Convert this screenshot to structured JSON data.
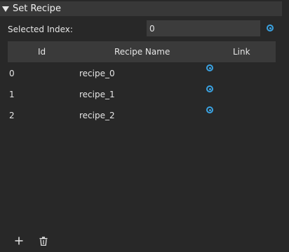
{
  "panel": {
    "title": "Set Recipe"
  },
  "selected_index": {
    "label": "Selected Index:",
    "value": "0"
  },
  "table": {
    "columns": [
      "Id",
      "Recipe Name",
      "Link"
    ],
    "rows": [
      {
        "id": "0",
        "name": "recipe_0"
      },
      {
        "id": "1",
        "name": "recipe_1"
      },
      {
        "id": "2",
        "name": "recipe_2"
      }
    ]
  },
  "colors": {
    "background": "#282828",
    "header": "#383838",
    "accent": "#3aa3e3"
  },
  "icons": {
    "collapse": "triangle-down-icon",
    "link": "radio-link-icon",
    "add": "plus-icon",
    "delete": "trash-icon"
  }
}
